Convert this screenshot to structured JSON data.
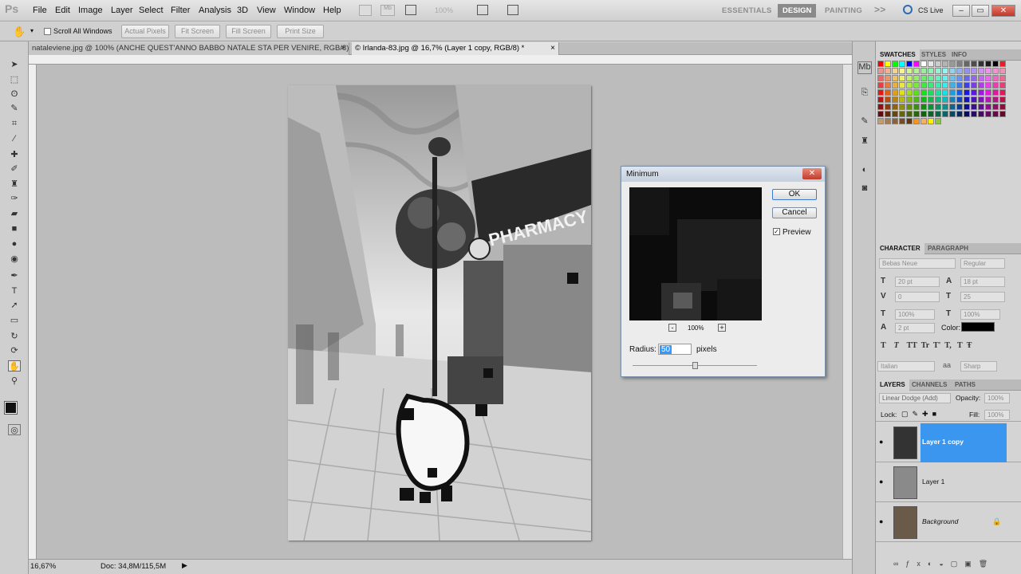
{
  "app": {
    "logo": "Ps",
    "title": "Photoshop"
  },
  "menu": [
    "File",
    "Edit",
    "Image",
    "Layer",
    "Select",
    "Filter",
    "Analysis",
    "3D",
    "View",
    "Window",
    "Help"
  ],
  "zoom_field": "100%",
  "workspaces": {
    "essentials": "ESSENTIALS",
    "design": "DESIGN",
    "painting": "PAINTING",
    "more": ">>",
    "cslive": "CS Live"
  },
  "options": {
    "scroll_all": "Scroll All Windows",
    "actual_pixels": "Actual Pixels",
    "fit_screen": "Fit Screen",
    "fill_screen": "Fill Screen",
    "print_size": "Print Size"
  },
  "tabs": [
    {
      "label": "nataleviene.jpg @ 100% (ANCHE QUEST'ANNO BABBO NATALE STA PER VENIRE, RGB/8) *"
    },
    {
      "label": "© Irlanda-83.jpg @ 16,7% (Layer 1 copy, RGB/8) *"
    }
  ],
  "status": {
    "zoom": "16,67%",
    "doc": "Doc: 34,8M/115,5M"
  },
  "swatch_panel": {
    "tabs": [
      "SWATCHES",
      "STYLES",
      "INFO"
    ]
  },
  "character": {
    "tabs": [
      "CHARACTER",
      "PARAGRAPH"
    ],
    "font": "Bebas Neue",
    "style": "Regular",
    "size": "20 pt",
    "leading": "18 pt",
    "kerning": "0",
    "tracking": "25",
    "vscale": "100%",
    "hscale": "100%",
    "baseline": "2 pt",
    "color_label": "Color:",
    "language": "Italian",
    "aa_label": "aa",
    "aa": "Sharp",
    "type_buttons": [
      "T",
      "T",
      "TT",
      "Tr",
      "T'",
      "T,",
      "T",
      "Ŧ"
    ]
  },
  "layers": {
    "tabs": [
      "LAYERS",
      "CHANNELS",
      "PATHS"
    ],
    "blend": "Linear Dodge (Add)",
    "opacity_label": "Opacity:",
    "opacity": "100%",
    "lock_label": "Lock:",
    "fill_label": "Fill:",
    "fill": "100%",
    "items": [
      {
        "name": "Layer 1 copy"
      },
      {
        "name": "Layer 1"
      },
      {
        "name": "Background"
      }
    ]
  },
  "dialog": {
    "title": "Minimum",
    "ok": "OK",
    "cancel": "Cancel",
    "preview": "Preview",
    "zoom": "100%",
    "minus": "-",
    "plus": "+",
    "radius_label": "Radius:",
    "radius": "50",
    "unit": "pixels"
  }
}
